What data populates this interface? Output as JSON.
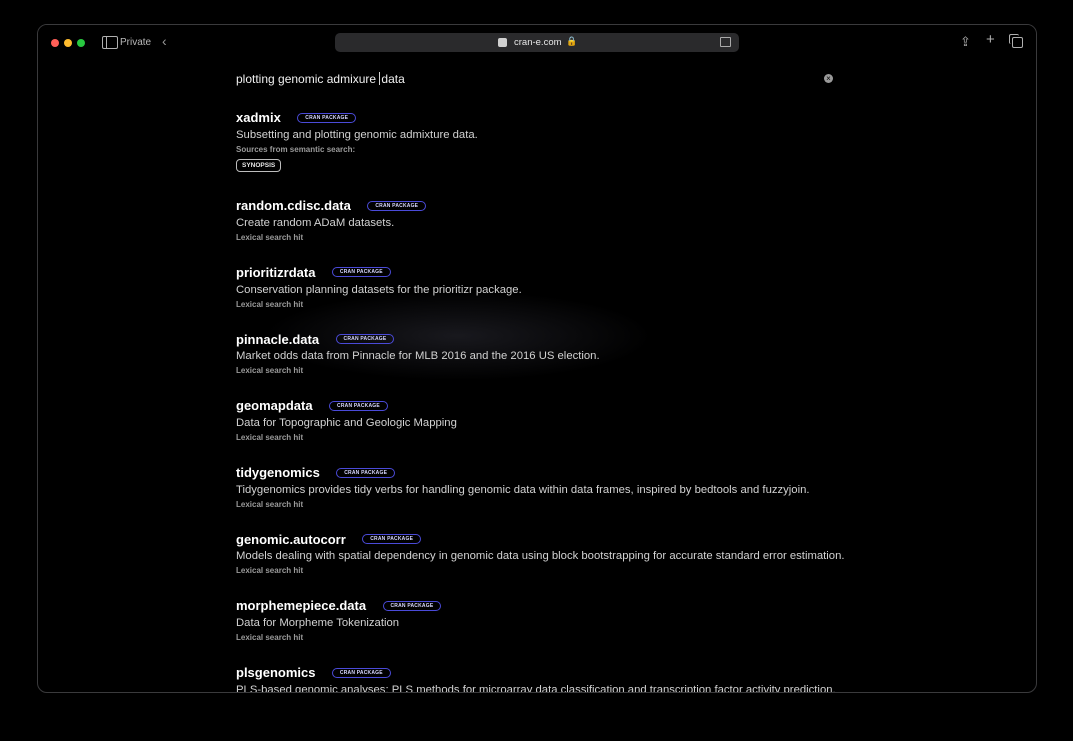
{
  "browser": {
    "private_label": "Private",
    "url": "cran-e.com",
    "back_glyph": "‹",
    "lock_glyph": "🔒",
    "share_glyph": "⇪",
    "plus_glyph": "+",
    "icons": [
      "sidebar-icon",
      "back-icon",
      "favicon-icon",
      "lock-icon",
      "reader-icon",
      "share-icon",
      "new-tab-icon",
      "tab-overview-icon"
    ]
  },
  "search": {
    "query_before_caret": "plotting genomic admixure ",
    "query_after_caret": "data",
    "clear_glyph": "×"
  },
  "badge_label": "CRAN PACKAGE",
  "results": [
    {
      "name": "xadmix",
      "description": "Subsetting and plotting genomic admixture data.",
      "source": "Sources from semantic search:",
      "synopsis": "SYNOPSIS"
    },
    {
      "name": "random.cdisc.data",
      "description": "Create random ADaM datasets.",
      "source": "Lexical search hit"
    },
    {
      "name": "prioritizrdata",
      "description": "Conservation planning datasets for the prioritizr package.",
      "source": "Lexical search hit"
    },
    {
      "name": "pinnacle.data",
      "description": "Market odds data from Pinnacle for MLB 2016 and the 2016 US election.",
      "source": "Lexical search hit"
    },
    {
      "name": "geomapdata",
      "description": "Data for Topographic and Geologic Mapping",
      "source": "Lexical search hit"
    },
    {
      "name": "tidygenomics",
      "description": "Tidygenomics provides tidy verbs for handling genomic data within data frames, inspired by bedtools and fuzzyjoin.",
      "source": "Lexical search hit"
    },
    {
      "name": "genomic.autocorr",
      "description": "Models dealing with spatial dependency in genomic data using block bootstrapping for accurate standard error estimation.",
      "source": "Lexical search hit"
    },
    {
      "name": "morphemepiece.data",
      "description": "Data for Morpheme Tokenization",
      "source": "Lexical search hit"
    },
    {
      "name": "plsgenomics",
      "description": "PLS-based genomic analyses; PLS methods for microarray data classification and transcription factor activity prediction.",
      "source": ""
    }
  ],
  "colors": {
    "background": "#000000",
    "badge_border": "#4a4ad8",
    "close": "#ff5f57",
    "minimize": "#febc2e",
    "zoom": "#28c840"
  }
}
